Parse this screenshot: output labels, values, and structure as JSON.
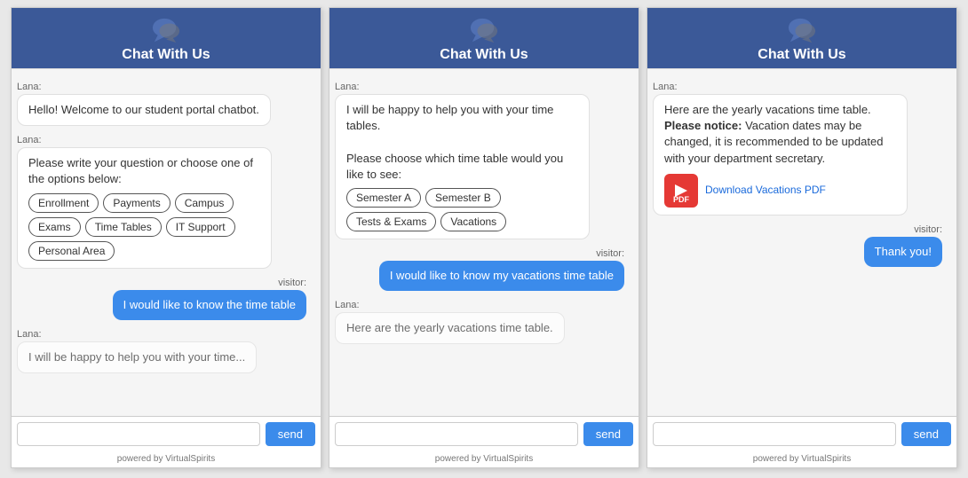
{
  "panels": [
    {
      "id": "panel1",
      "header": {
        "title": "Chat With Us"
      },
      "messages": [
        {
          "type": "lana",
          "text": "Hello! Welcome to our student portal chatbot."
        },
        {
          "type": "lana",
          "text": "Please write your question or choose one of the options below:",
          "options": [
            "Enrollment",
            "Payments",
            "Campus",
            "Exams",
            "Time Tables",
            "IT Support",
            "Personal Area"
          ]
        },
        {
          "type": "visitor",
          "text": "I would like to know the time table"
        },
        {
          "type": "lana",
          "text": "I will be happy to help you with your time...",
          "partial": true
        }
      ],
      "input_placeholder": "",
      "send_label": "send",
      "powered_by": "powered by VirtualSpirits"
    },
    {
      "id": "panel2",
      "header": {
        "title": "Chat With Us"
      },
      "messages": [
        {
          "type": "lana",
          "text": "I will be happy to help you with your time tables.\n\nPlease choose which time table would you like to see:",
          "options": [
            "Semester A",
            "Semester B",
            "Tests & Exams",
            "Vacations"
          ]
        },
        {
          "type": "visitor",
          "text": "I would like to know my vacations time table"
        },
        {
          "type": "lana",
          "text": "Here are the yearly vacations time table.",
          "partial": true
        }
      ],
      "input_placeholder": "",
      "send_label": "send",
      "powered_by": "powered by VirtualSpirits"
    },
    {
      "id": "panel3",
      "header": {
        "title": "Chat With Us"
      },
      "messages": [
        {
          "type": "lana",
          "text_parts": [
            {
              "text": "Here are the yearly vacations time table.",
              "bold": false
            },
            {
              "text": "Please notice:",
              "bold": true
            },
            {
              "text": " Vacation dates may be changed, it is recommended to be updated with your department secretary.",
              "bold": false
            }
          ],
          "has_pdf": true,
          "pdf_link_text": "Download Vacations PDF"
        },
        {
          "type": "visitor",
          "text": "Thank you!"
        }
      ],
      "input_placeholder": "",
      "send_label": "send",
      "powered_by": "powered by VirtualSpirits"
    }
  ],
  "labels": {
    "lana": "Lana:",
    "visitor": "visitor:"
  }
}
